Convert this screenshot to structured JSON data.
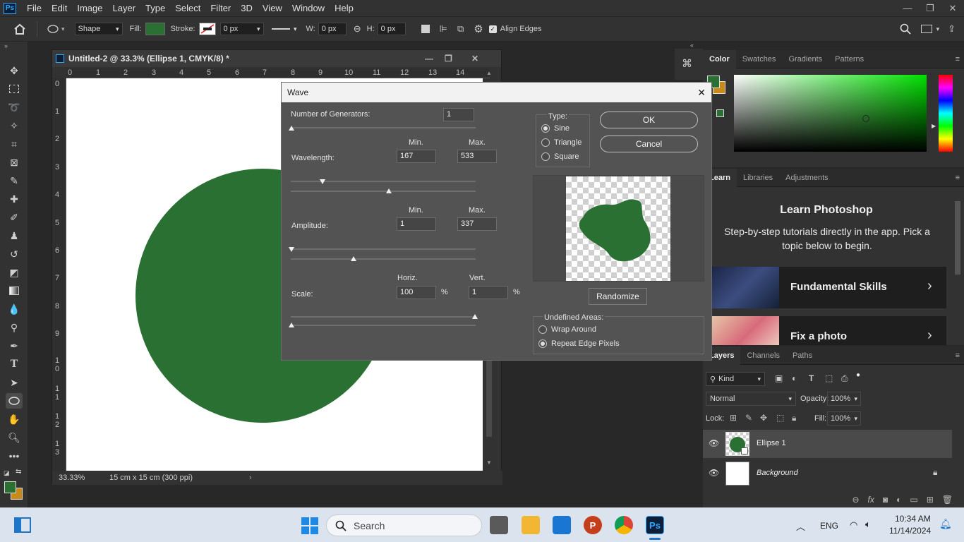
{
  "app": {
    "logo": "Ps"
  },
  "menu": [
    "File",
    "Edit",
    "Image",
    "Layer",
    "Type",
    "Select",
    "Filter",
    "3D",
    "View",
    "Window",
    "Help"
  ],
  "window_controls": {
    "minimize": "—",
    "restore": "❐",
    "close": "✕"
  },
  "options": {
    "mode": "Shape",
    "fill_label": "Fill:",
    "stroke_label": "Stroke:",
    "stroke_size": "0 px",
    "w_label": "W:",
    "w_value": "0 px",
    "h_label": "H:",
    "h_value": "0 px",
    "align_edges": "Align Edges",
    "fill_color": "#2a7033"
  },
  "document": {
    "title": "Untitled-2 @ 33.3% (Ellipse 1, CMYK/8) *",
    "ruler_h": [
      "0",
      "1",
      "2",
      "3",
      "4",
      "5",
      "6",
      "7",
      "8",
      "9",
      "10",
      "11",
      "12",
      "13",
      "14"
    ],
    "ruler_v": [
      "0",
      "1",
      "2",
      "3",
      "4",
      "5",
      "6",
      "7",
      "8",
      "9",
      "10",
      "11",
      "12",
      "13"
    ],
    "zoom": "33.33%",
    "size_info": "15 cm x 15 cm (300 ppi)",
    "ellipse_color": "#2a7033"
  },
  "dialog": {
    "title": "Wave",
    "close": "✕",
    "generators_label": "Number of Generators:",
    "generators_value": "1",
    "min_label": "Min.",
    "max_label": "Max.",
    "wavelength_label": "Wavelength:",
    "wavelength_min": "167",
    "wavelength_max": "533",
    "amplitude_label": "Amplitude:",
    "amplitude_min": "1",
    "amplitude_max": "337",
    "scale_label": "Scale:",
    "horiz_label": "Horiz.",
    "vert_label": "Vert.",
    "scale_horiz": "100",
    "scale_vert": "1",
    "percent": "%",
    "type_label": "Type:",
    "type_options": [
      "Sine",
      "Triangle",
      "Square"
    ],
    "ok": "OK",
    "cancel": "Cancel",
    "randomize": "Randomize",
    "undefined_label": "Undefined Areas:",
    "undefined_options": [
      "Wrap Around",
      "Repeat Edge Pixels"
    ]
  },
  "color_panel": {
    "tabs": [
      "Color",
      "Swatches",
      "Gradients",
      "Patterns"
    ],
    "foreground": "#2a7033",
    "background": "#c98a17"
  },
  "learn_panel": {
    "tabs": [
      "Learn",
      "Libraries",
      "Adjustments"
    ],
    "heading": "Learn Photoshop",
    "subtitle": "Step-by-step tutorials directly in the app. Pick a topic below to begin.",
    "cards": [
      "Fundamental Skills",
      "Fix a photo"
    ]
  },
  "layers_panel": {
    "tabs": [
      "Layers",
      "Channels",
      "Paths"
    ],
    "filter": "Kind",
    "blend_mode": "Normal",
    "opacity_label": "Opacity:",
    "opacity": "100%",
    "lock_label": "Lock:",
    "fill_label": "Fill:",
    "fill": "100%",
    "layers": [
      {
        "name": "Ellipse 1",
        "visible": true
      },
      {
        "name": "Background",
        "visible": true
      }
    ]
  },
  "taskbar": {
    "search_placeholder": "Search",
    "language": "ENG",
    "time": "10:34 AM",
    "date": "11/14/2024"
  }
}
